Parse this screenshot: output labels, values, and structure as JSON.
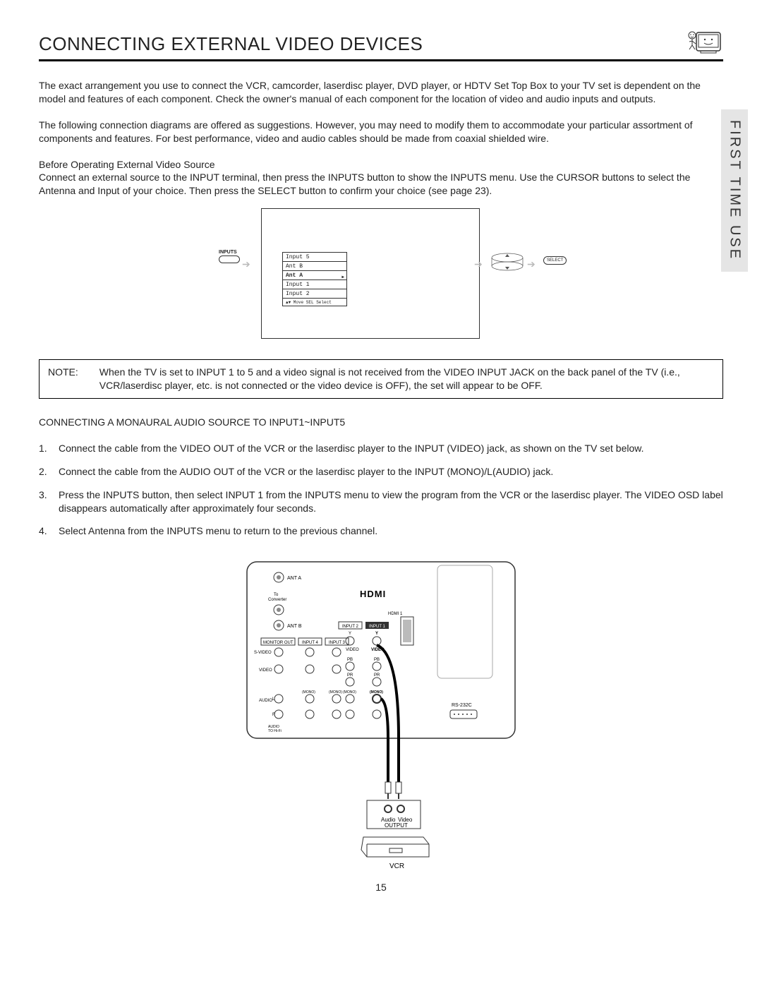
{
  "header": {
    "title": "CONNECTING EXTERNAL VIDEO DEVICES"
  },
  "side_tab": "FIRST TIME USE",
  "intro_p1": "The exact arrangement you use to connect the VCR, camcorder, laserdisc player, DVD player, or HDTV Set Top Box to your TV set is dependent on the model and features of each component.  Check the owner's manual of each component for the location of video and audio inputs and outputs.",
  "intro_p2": "The following connection diagrams are offered as suggestions.  However, you may need to modify them to accommodate your particular assortment of components and features.  For best performance, video and audio cables should be made from coaxial shielded wire.",
  "before_heading": "Before Operating External Video Source",
  "before_body": "Connect an external source to the INPUT terminal, then press the INPUTS button to show the INPUTS menu.  Use the CURSOR buttons to select the Antenna and Input of your choice.  Then press the SELECT button to confirm your choice (see page 23).",
  "diagram1": {
    "inputs_label": "INPUTS",
    "rows": [
      "Input 5",
      "Ant B",
      "Ant A",
      "Input 1",
      "Input 2"
    ],
    "hint": "▲▼ Move  SEL  Select",
    "select_btn": "SELECT"
  },
  "note": {
    "label": "NOTE:",
    "text": "When the TV is set to INPUT 1 to 5 and a video signal is not received from the VIDEO INPUT JACK on the back panel of the TV (i.e., VCR/laserdisc player, etc. is not connected or the video device is OFF), the set will appear to be OFF."
  },
  "mono_heading": "CONNECTING A MONAURAL AUDIO SOURCE TO INPUT1~INPUT5",
  "steps": [
    "Connect the cable from the VIDEO OUT of the VCR or the laserdisc player to the INPUT (VIDEO) jack, as shown on the TV set below.",
    "Connect the cable from the AUDIO OUT of the VCR or the laserdisc player to the INPUT (MONO)/L(AUDIO) jack.",
    "Press the INPUTS button, then select INPUT 1 from the INPUTS menu to view the program from the VCR or the laserdisc player.  The VIDEO OSD label disappears automatically after approximately four seconds.",
    "Select Antenna from the INPUTS menu to return to the previous channel."
  ],
  "diagram2": {
    "hdmi": "HDMI",
    "hdmi1": "HDMI 1",
    "ant_a": "ANT A",
    "to_conv": "To Converter",
    "ant_b": "ANT B",
    "monitor_out": "MONITOR OUT",
    "svideo": "S-VIDEO",
    "video": "VIDEO",
    "audio": "AUDIO",
    "audio_to_hifi": "AUDIO TO Hi-Fi",
    "input4": "INPUT 4",
    "input3": "INPUT 3",
    "input2": "INPUT 2",
    "input1": "INPUT 1",
    "mono": "(MONO)",
    "y": "Y",
    "pb": "PB",
    "pr": "PR",
    "l": "L",
    "r": "R",
    "rs232c": "RS-232C",
    "audio_out": "Audio",
    "video_out": "Video",
    "output": "OUTPUT",
    "vcr": "VCR"
  },
  "page": "15"
}
